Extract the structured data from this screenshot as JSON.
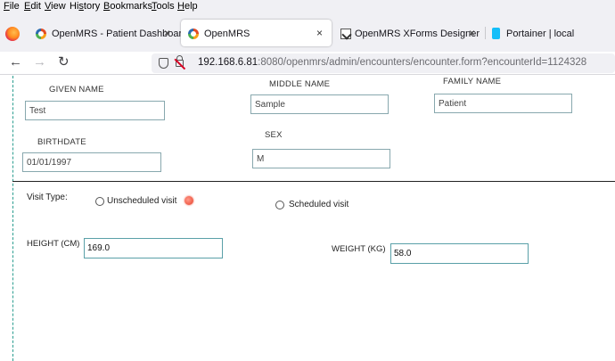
{
  "menu": [
    {
      "accel": "F",
      "rest": "ile"
    },
    {
      "accel": "E",
      "rest": "dit"
    },
    {
      "accel": "V",
      "rest": "iew"
    },
    {
      "pre": "Hi",
      "accel": "s",
      "rest": "tory"
    },
    {
      "accel": "B",
      "rest": "ookmarks"
    },
    {
      "accel": "T",
      "rest": "ools"
    },
    {
      "accel": "H",
      "rest": "elp"
    }
  ],
  "tabs": [
    {
      "title": "OpenMRS - Patient Dashboard",
      "icon": "openmrs-icon",
      "active": false
    },
    {
      "title": "OpenMRS",
      "icon": "openmrs-icon",
      "active": true
    },
    {
      "title": "OpenMRS XForms Designer",
      "icon": "xforms-icon",
      "active": false
    },
    {
      "title": "Portainer | local",
      "icon": "portainer-icon",
      "active": false
    }
  ],
  "tab_close_glyph": "×",
  "nav": {
    "back_glyph": "←",
    "forward_glyph": "→",
    "reload_glyph": "↻"
  },
  "url": {
    "host": "192.168.6.81",
    "rest": ":8080/openmrs/admin/encounters/encounter.form?encounterId=1124328"
  },
  "form": {
    "given_name": {
      "label": "GIVEN NAME",
      "value": "Test"
    },
    "middle_name": {
      "label": "MIDDLE NAME",
      "value": "Sample"
    },
    "family_name": {
      "label": "FAMILY NAME",
      "value": "Patient"
    },
    "birthdate": {
      "label": "BIRTHDATE",
      "value": "01/01/1997"
    },
    "sex": {
      "label": "SEX",
      "value": "M"
    },
    "visit_type": {
      "label": "Visit Type:",
      "options": [
        "Unscheduled visit",
        "Scheduled visit"
      ]
    },
    "height": {
      "label": "HEIGHT (CM)",
      "value": "169.0"
    },
    "weight": {
      "label": "WEIGHT (KG)",
      "value": "58.0"
    }
  },
  "colors": {
    "chrome_bg": "#f0f0f4",
    "field_border": "#88a8ae",
    "left_rule": "#2a9d8f",
    "required_dot": "#f2634f"
  }
}
